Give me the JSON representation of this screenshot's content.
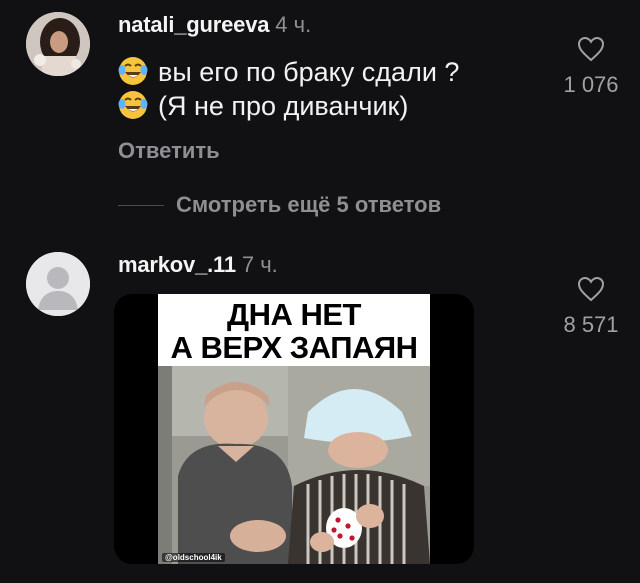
{
  "comments": [
    {
      "username": "natali_gureeva",
      "time": "4 ч.",
      "lines": [
        "вы его по браку сдали ?",
        "(Я не про диванчик)"
      ],
      "likes": "1 076",
      "reply_label": "Ответить",
      "emoji_icon": "laughing-tears-emoji"
    },
    {
      "username": "markov_.11",
      "time": "7 ч.",
      "likes": "8 571",
      "meme": {
        "caption_line1": "ДНА НЕТ",
        "caption_line2": "А ВЕРХ ЗАПАЯН",
        "watermark": "@oldschool4ik"
      }
    }
  ],
  "more_replies_label": "Смотреть ещё 5 ответов",
  "colors": {
    "background": "#111113",
    "secondary_text": "#8e8e93",
    "primary_text": "#f2f2f2"
  },
  "icons": {
    "like": "heart-outline-icon",
    "default_avatar": "user-silhouette-icon"
  }
}
